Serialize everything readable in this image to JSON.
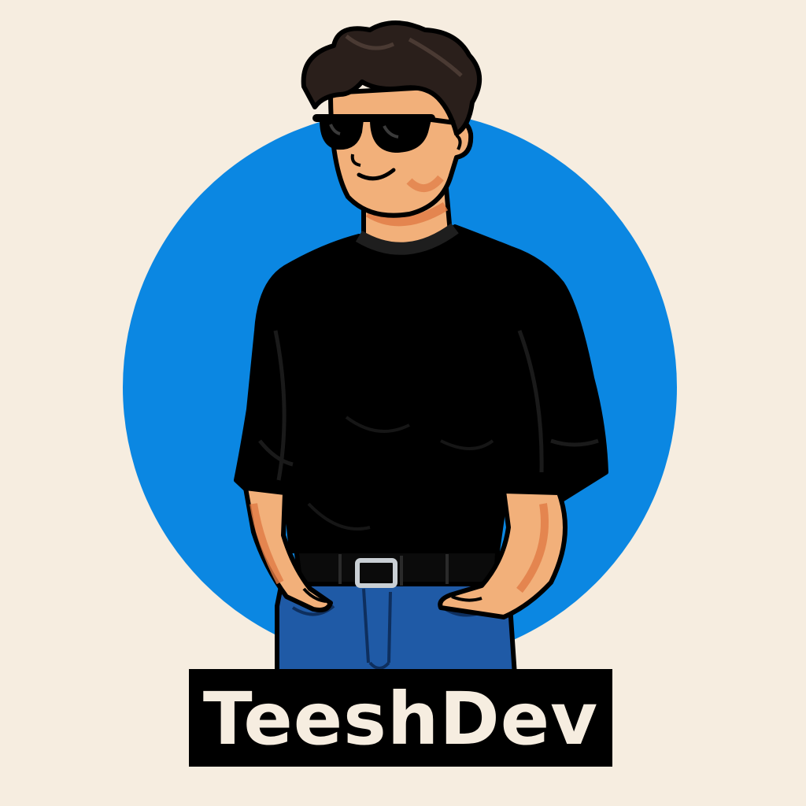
{
  "logo": {
    "name": "TeeshDev"
  },
  "colors": {
    "background": "#F6EDE0",
    "circle": "#0B87E2",
    "shirt": "#000000",
    "skin": "#F2B07A",
    "skin_shadow": "#E07A45",
    "hair": "#2A1F1B",
    "jeans": "#1F5AA6",
    "badge": "#000000",
    "badge_text": "#F6EDE0"
  }
}
